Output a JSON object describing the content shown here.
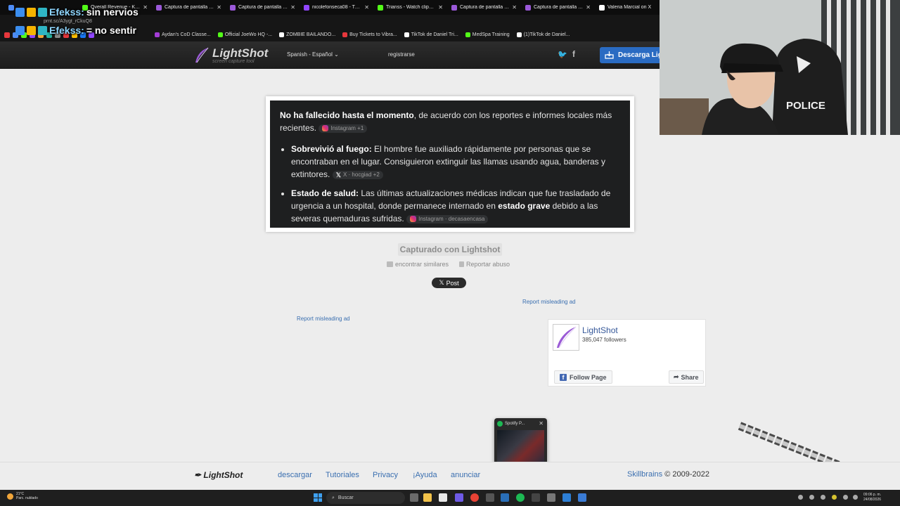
{
  "browser": {
    "tabs": [
      {
        "label": "",
        "color": "#4f8cf5"
      },
      {
        "label": "Overall Revenue - Kick Da",
        "color": "#53fc18"
      },
      {
        "label": "Captura de pantalla por Li",
        "color": "#9b59d9"
      },
      {
        "label": "Captura de pantalla por Li",
        "color": "#9b59d9"
      },
      {
        "label": "nicolefonseca08 - Twitch",
        "color": "#9146ff"
      },
      {
        "label": "Trianss - Watch clips on K",
        "color": "#53fc18"
      },
      {
        "label": "Captura de pantalla por Li",
        "color": "#9b59d9"
      },
      {
        "label": "Captura de pantalla por Li",
        "color": "#9b59d9"
      },
      {
        "label": "Valeria Marcial on X",
        "color": "#ffffff"
      }
    ],
    "url": "prnt.sc/A3ygt_rCkuQ8",
    "bookmarks": [
      {
        "label": "Aydan's CoD Classe...",
        "color": "#a33cd6"
      },
      {
        "label": "Official JoeWo HQ -...",
        "color": "#53fc18"
      },
      {
        "label": "ZOMBIE BAILANDO...",
        "color": "#ffffff"
      },
      {
        "label": "Buy Tickets to Vibra...",
        "color": "#e6373c"
      },
      {
        "label": "TikTok de Daniel Tri...",
        "color": "#ffffff"
      },
      {
        "label": "MedSpa Training",
        "color": "#53fc18"
      },
      {
        "label": "(1)TikTok de Daniel...",
        "color": "#ffffff"
      }
    ]
  },
  "overlay": {
    "chat": [
      {
        "user": "Efekss:",
        "msg": "sin nervios"
      },
      {
        "user": "Efekss:",
        "msg": "= no sentir"
      }
    ]
  },
  "site": {
    "logo": "LightShot",
    "logo_sub": "screen capture tool",
    "language": "Spanish - Español",
    "register": "registrarse",
    "download": "Descarga Lig"
  },
  "shot": {
    "intro_bold": "No ha fallecido hasta el momento",
    "intro_rest": ", de acuerdo con los reportes e informes locales más recientes.",
    "intro_cite": "Instagram +1",
    "bullets": [
      {
        "bold": "Sobrevivió al fuego:",
        "text": " El hombre fue auxiliado rápidamente por personas que se encontraban en el lugar. Consiguieron extinguir las llamas usando agua, banderas y extintores.",
        "cite": "X · hocgiad +2"
      },
      {
        "bold": "Estado de salud:",
        "text": " Las últimas actualizaciones médicas indican que fue trasladado de urgencia a un hospital, donde permanece internado en ",
        "bold2": "estado grave",
        "text2": " debido a las severas quemaduras sufridas.",
        "cite": "Instagram · decasaencasa"
      }
    ]
  },
  "actions": {
    "captured": "Capturado con Lightshot",
    "find_similar": "encontrar similares",
    "report_abuse": "Reportar abuso",
    "x_post": "Post",
    "report_ad": "Report misleading ad"
  },
  "fb": {
    "name": "LightShot",
    "followers": "385,047 followers",
    "follow": "Follow Page",
    "share": "Share"
  },
  "spotify": {
    "title": "Spotify P..."
  },
  "footer": {
    "logo": "LightShot",
    "links": [
      "descargar",
      "Tutoriales",
      "Privacy",
      "¡Ayuda",
      "anunciar"
    ],
    "skillbrains": "Skillbrains",
    "copyright": " © 2009-2022"
  },
  "taskbar": {
    "temp": "21°C",
    "weather": "Parc. nublado",
    "search": "Buscar",
    "time": "09:06 p. m.",
    "date": "24/08/2026"
  }
}
